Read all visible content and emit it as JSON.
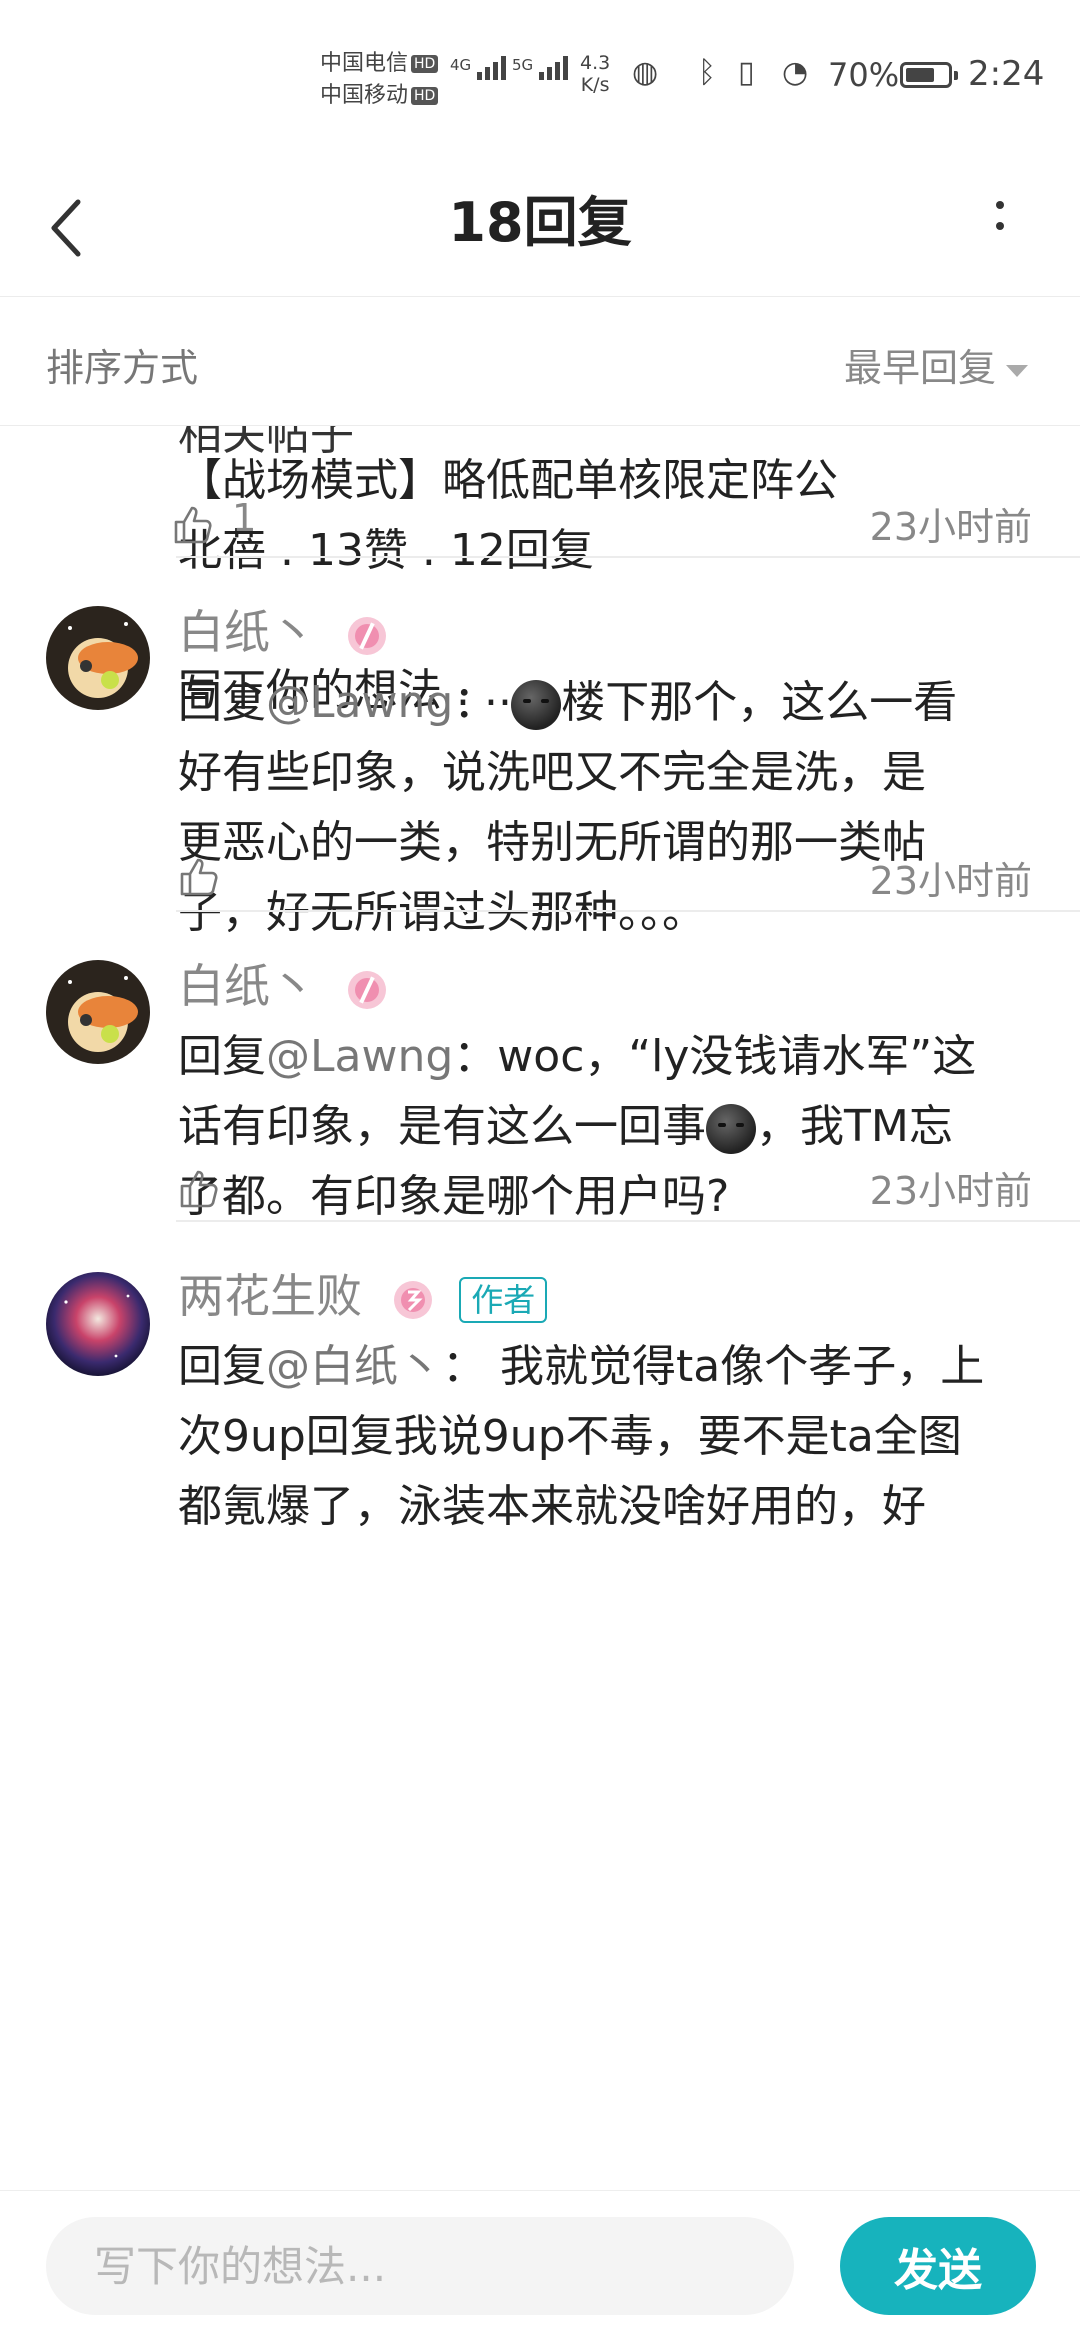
{
  "status_bar": {
    "carrier1": "中国电信",
    "carrier2": "中国移动",
    "hd": "HD",
    "net1": "4G",
    "net2": "5G",
    "speed_value": "4.3",
    "speed_unit": "K/s",
    "battery_percent": "70%",
    "battery_level": 0.7,
    "time": "2:24"
  },
  "header": {
    "title": "18回复"
  },
  "sort": {
    "label": "排序方式",
    "value": "最早回复"
  },
  "quoted_post": {
    "cut_line": "相关帖子",
    "line1": "【战场模式】略低配单核限定阵公",
    "line2": "北蓓 . 13赞 . 12回复",
    "line3": "写下你的想法 . ...",
    "likes": "1",
    "time": "23小时前"
  },
  "comments": [
    {
      "name": "白纸丶",
      "reply_prefix": "回复",
      "mention": "@Lawng",
      "sep": "：",
      "lines": [
        "楼下那个，这么一看",
        "好有些印象，说洗吧又不完全是洗，是",
        "更恶心的一类，特别无所谓的那一类帖",
        "子，好无所谓过头那种。。。"
      ],
      "time": "23小时前"
    },
    {
      "name": "白纸丶",
      "reply_prefix": "回复",
      "mention": "@Lawng",
      "sep": "：",
      "lines": [
        "woc，“ly没钱请水军”这",
        "话有印象，是有这么一回事",
        "，我TM忘",
        "了都。有印象是哪个用户吗?"
      ],
      "time": "23小时前"
    },
    {
      "name": "两花生败",
      "author_tag": "作者",
      "reply_prefix": "回复",
      "mention": "@白纸丶",
      "sep": "：",
      "lines": [
        " 我就觉得ta像个孝子，上",
        "次9up回复我说9up不毒，要不是ta全图",
        "都氪爆了，泳装本来就没啥好用的，好"
      ]
    }
  ],
  "input": {
    "placeholder": "写下你的想法..."
  },
  "send_button": {
    "label": "发送"
  },
  "colors": {
    "accent": "#17b3bd",
    "badge_pink": "#f08fb0",
    "mention_gray": "#777777"
  }
}
